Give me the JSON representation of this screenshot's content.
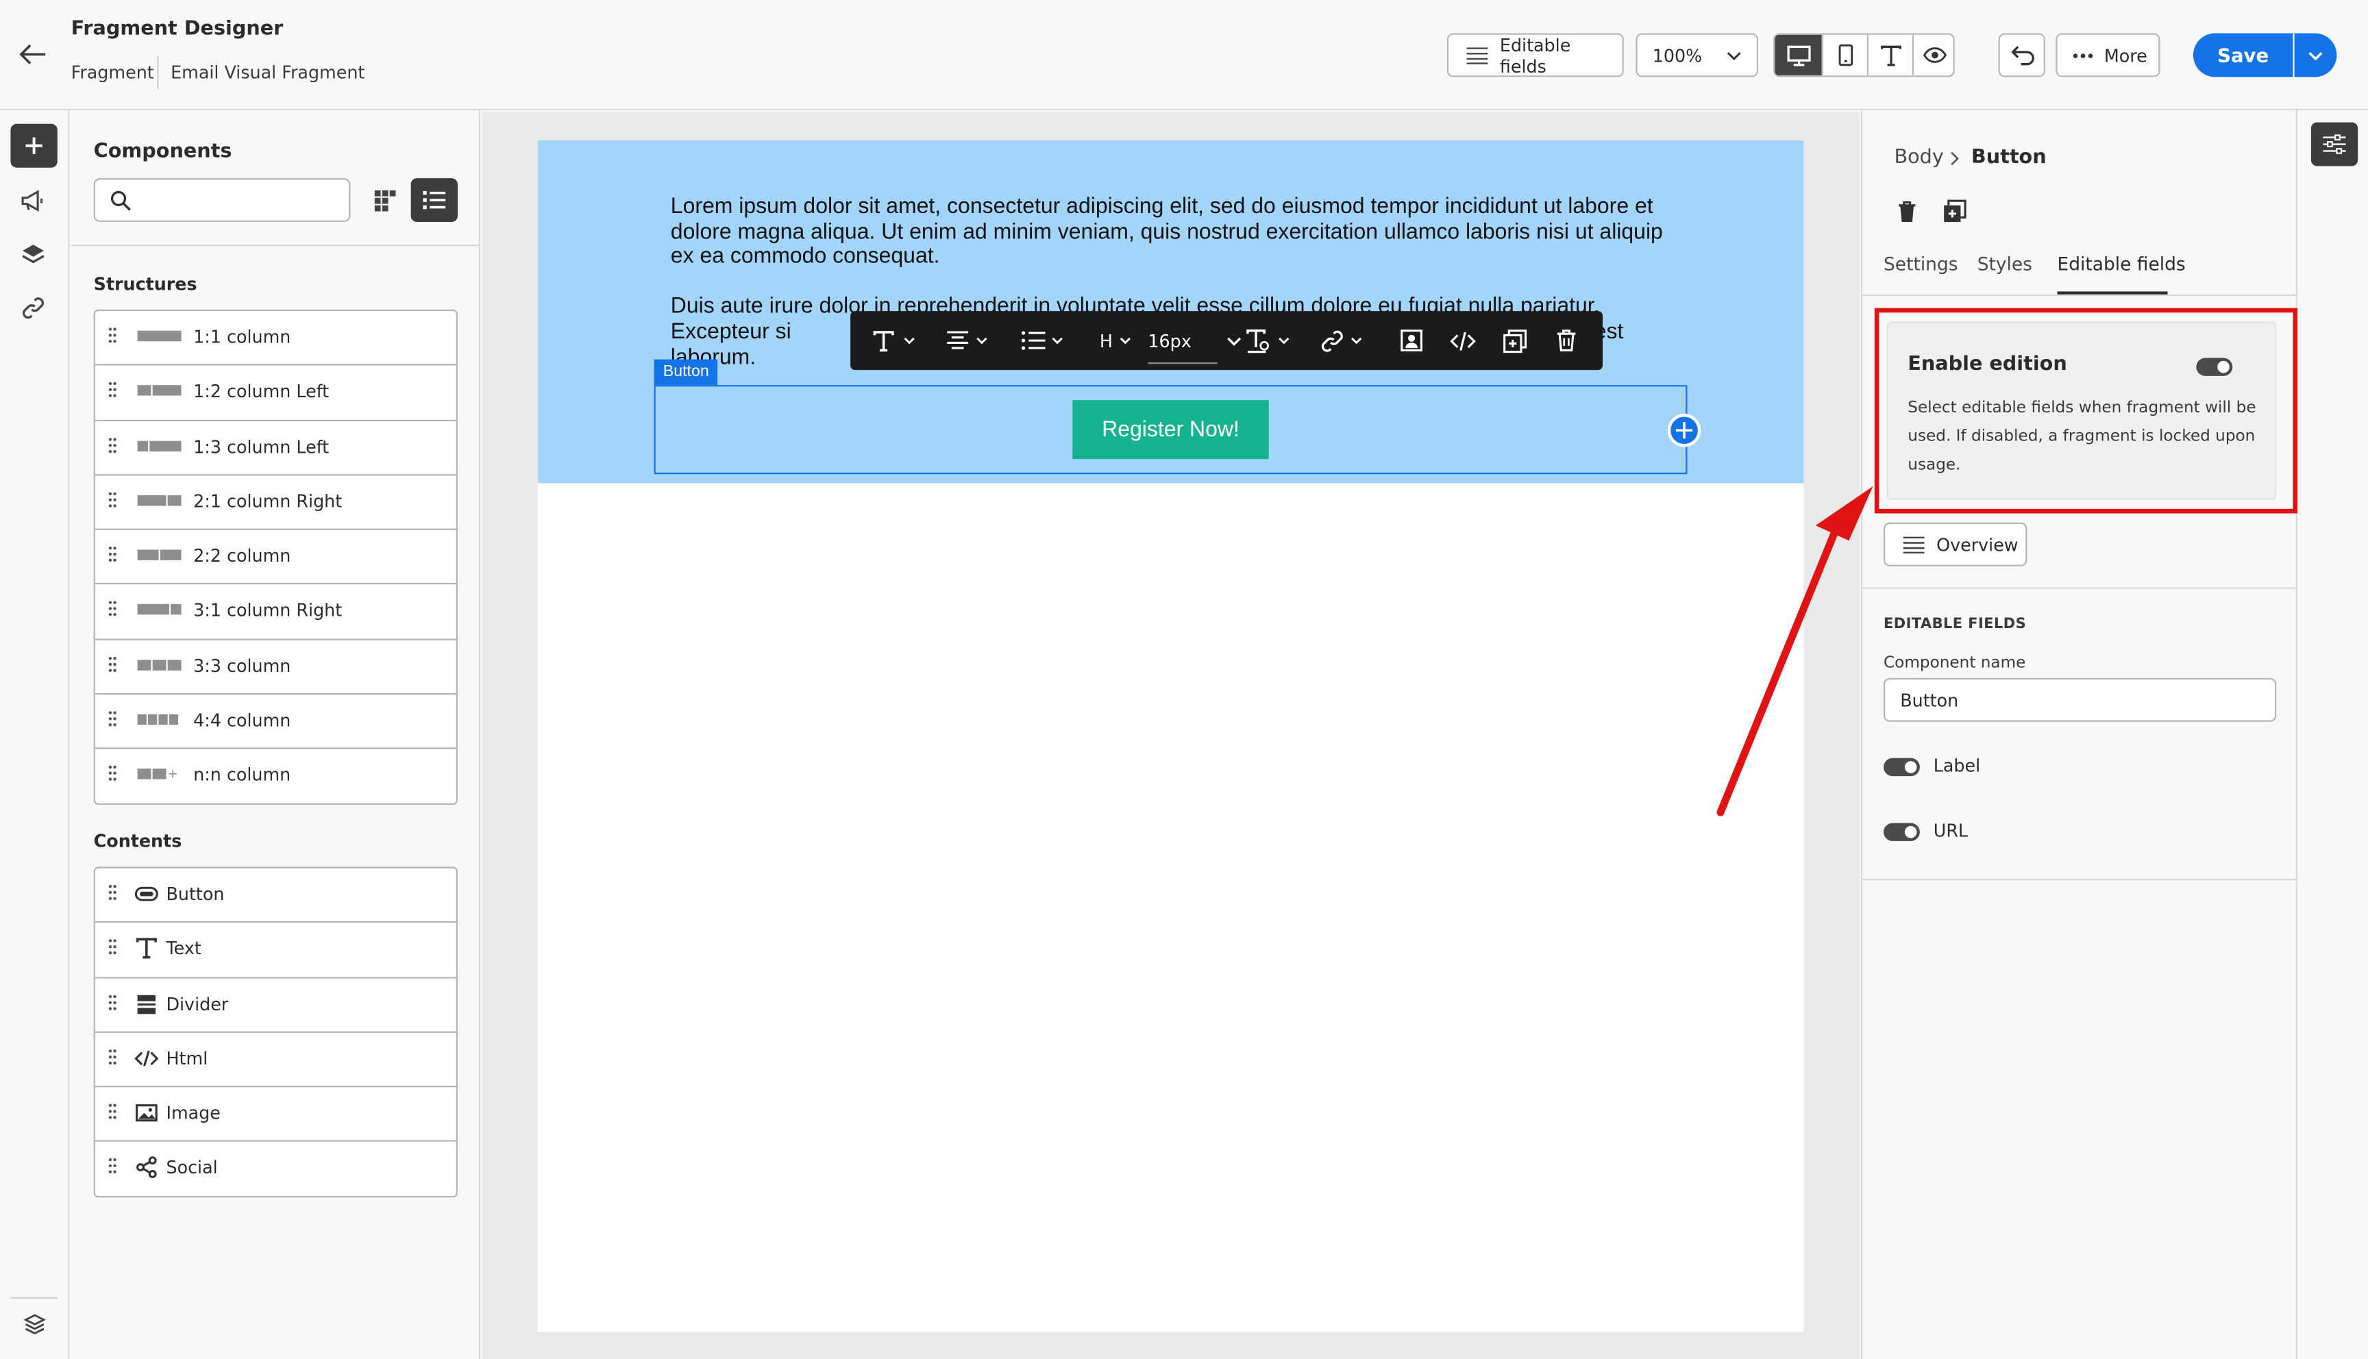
{
  "header": {
    "title": "Fragment Designer",
    "crumb_1": "Fragment",
    "crumb_2": "Email Visual Fragment",
    "editable_fields_label": "Editable fields",
    "zoom_value": "100%",
    "more_label": "More",
    "save_label": "Save"
  },
  "components": {
    "title": "Components",
    "search_placeholder": "",
    "structures_title": "Structures",
    "structures": [
      {
        "label": "1:1 column"
      },
      {
        "label": "1:2 column Left"
      },
      {
        "label": "1:3 column Left"
      },
      {
        "label": "2:1 column Right"
      },
      {
        "label": "2:2 column"
      },
      {
        "label": "3:1 column Right"
      },
      {
        "label": "3:3 column"
      },
      {
        "label": "4:4 column"
      },
      {
        "label": "n:n column"
      }
    ],
    "contents_title": "Contents",
    "contents": [
      {
        "label": "Button",
        "icon": "button-icon"
      },
      {
        "label": "Text",
        "icon": "text-icon"
      },
      {
        "label": "Divider",
        "icon": "divider-icon"
      },
      {
        "label": "Html",
        "icon": "code-icon"
      },
      {
        "label": "Image",
        "icon": "image-icon"
      },
      {
        "label": "Social",
        "icon": "share-icon"
      }
    ]
  },
  "canvas": {
    "paragraph_1": "Lorem ipsum dolor sit amet, consectetur adipiscing elit, sed do eiusmod tempor incididunt ut labore et dolore magna aliqua. Ut enim ad minim veniam, quis nostrud exercitation ullamco laboris nisi ut aliquip ex ea commodo consequat.",
    "paragraph_2_line_1": "Duis aute irure dolor in reprehenderit in voluptate velit esse cillum dolore eu fugiat nulla pariatur.",
    "paragraph_2_line_2_start": "Excepteur si",
    "paragraph_2_line_2_end": "m id est",
    "paragraph_2_line_3": "laborum.",
    "selected_tag": "Button",
    "button_text": "Register Now!",
    "toolbar_heading": "H",
    "toolbar_font_size": "16px"
  },
  "properties": {
    "breadcrumb_parent": "Body",
    "breadcrumb_current": "Button",
    "tabs": [
      {
        "label": "Settings"
      },
      {
        "label": "Styles"
      },
      {
        "label": "Editable fields"
      }
    ],
    "active_tab": "Editable fields",
    "enable_edition_title": "Enable edition",
    "enable_edition_desc": "Select editable fields when fragment will be used. If disabled, a fragment is locked upon usage.",
    "enable_edition_on": true,
    "overview_label": "Overview",
    "editable_fields_heading": "EDITABLE FIELDS",
    "component_name_label": "Component name",
    "component_name_value": "Button",
    "label_toggle_label": "Label",
    "url_toggle_label": "URL"
  },
  "colors": {
    "accent": "#1473e6",
    "hero_bg": "#a3d5fb",
    "cta_button": "#15b38f",
    "highlight": "#e01414"
  }
}
